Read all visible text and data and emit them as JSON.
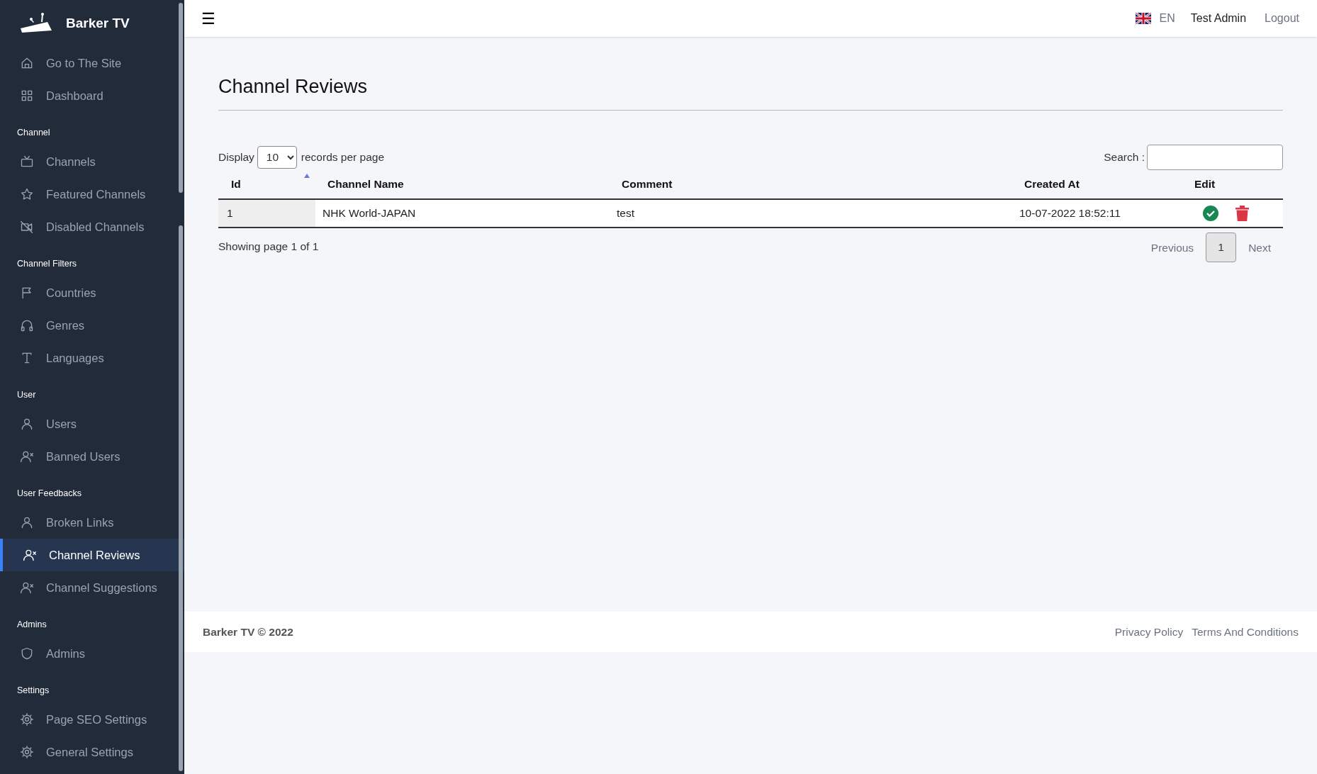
{
  "sidebar": {
    "brand": "Barker TV",
    "items": [
      {
        "label": "Go to The Site",
        "selected": false
      },
      {
        "label": "Dashboard",
        "selected": false
      }
    ],
    "sections": [
      {
        "title": "Channel",
        "items": [
          {
            "label": "Channels",
            "selected": false
          },
          {
            "label": "Featured Channels",
            "selected": false
          },
          {
            "label": "Disabled Channels",
            "selected": false
          }
        ]
      },
      {
        "title": "Channel Filters",
        "items": [
          {
            "label": "Countries",
            "selected": false
          },
          {
            "label": "Genres",
            "selected": false
          },
          {
            "label": "Languages",
            "selected": false
          }
        ]
      },
      {
        "title": "User",
        "items": [
          {
            "label": "Users",
            "selected": false
          },
          {
            "label": "Banned Users",
            "selected": false
          }
        ]
      },
      {
        "title": "User Feedbacks",
        "items": [
          {
            "label": "Broken Links",
            "selected": false
          },
          {
            "label": "Channel Reviews",
            "selected": true
          },
          {
            "label": "Channel Suggestions",
            "selected": false
          }
        ]
      },
      {
        "title": "Admins",
        "items": [
          {
            "label": "Admins",
            "selected": false
          }
        ]
      },
      {
        "title": "Settings",
        "items": [
          {
            "label": "Page SEO Settings",
            "selected": false
          },
          {
            "label": "General Settings",
            "selected": false
          }
        ]
      }
    ]
  },
  "topbar": {
    "menu_glyph": "☰",
    "language": "EN",
    "user": "Test Admin",
    "logout": "Logout"
  },
  "page": {
    "title": "Channel Reviews",
    "display_label": "Display",
    "page_size": "10",
    "per_page_label": "records per page",
    "search_label": "Search :",
    "table": {
      "columns": [
        {
          "label": "Id",
          "sorted": true
        },
        {
          "label": "Channel Name",
          "sorted": false
        },
        {
          "label": "Comment",
          "sorted": false
        },
        {
          "label": "Created At",
          "sorted": false
        },
        {
          "label": "Edit",
          "sorted": false
        }
      ],
      "rows": [
        {
          "id": "1",
          "channel_name": "NHK World-JAPAN",
          "comment": "test",
          "created_at": "10-07-2022 18:52:11"
        }
      ]
    },
    "info": "Showing page 1 of 1",
    "pagination": {
      "previous": "Previous",
      "pages": [
        {
          "label": "1",
          "selected": true
        }
      ],
      "next": "Next"
    }
  },
  "footer": {
    "copyright": "Barker TV © 2022",
    "links": [
      "Privacy Policy",
      "Terms And Conditions"
    ]
  }
}
